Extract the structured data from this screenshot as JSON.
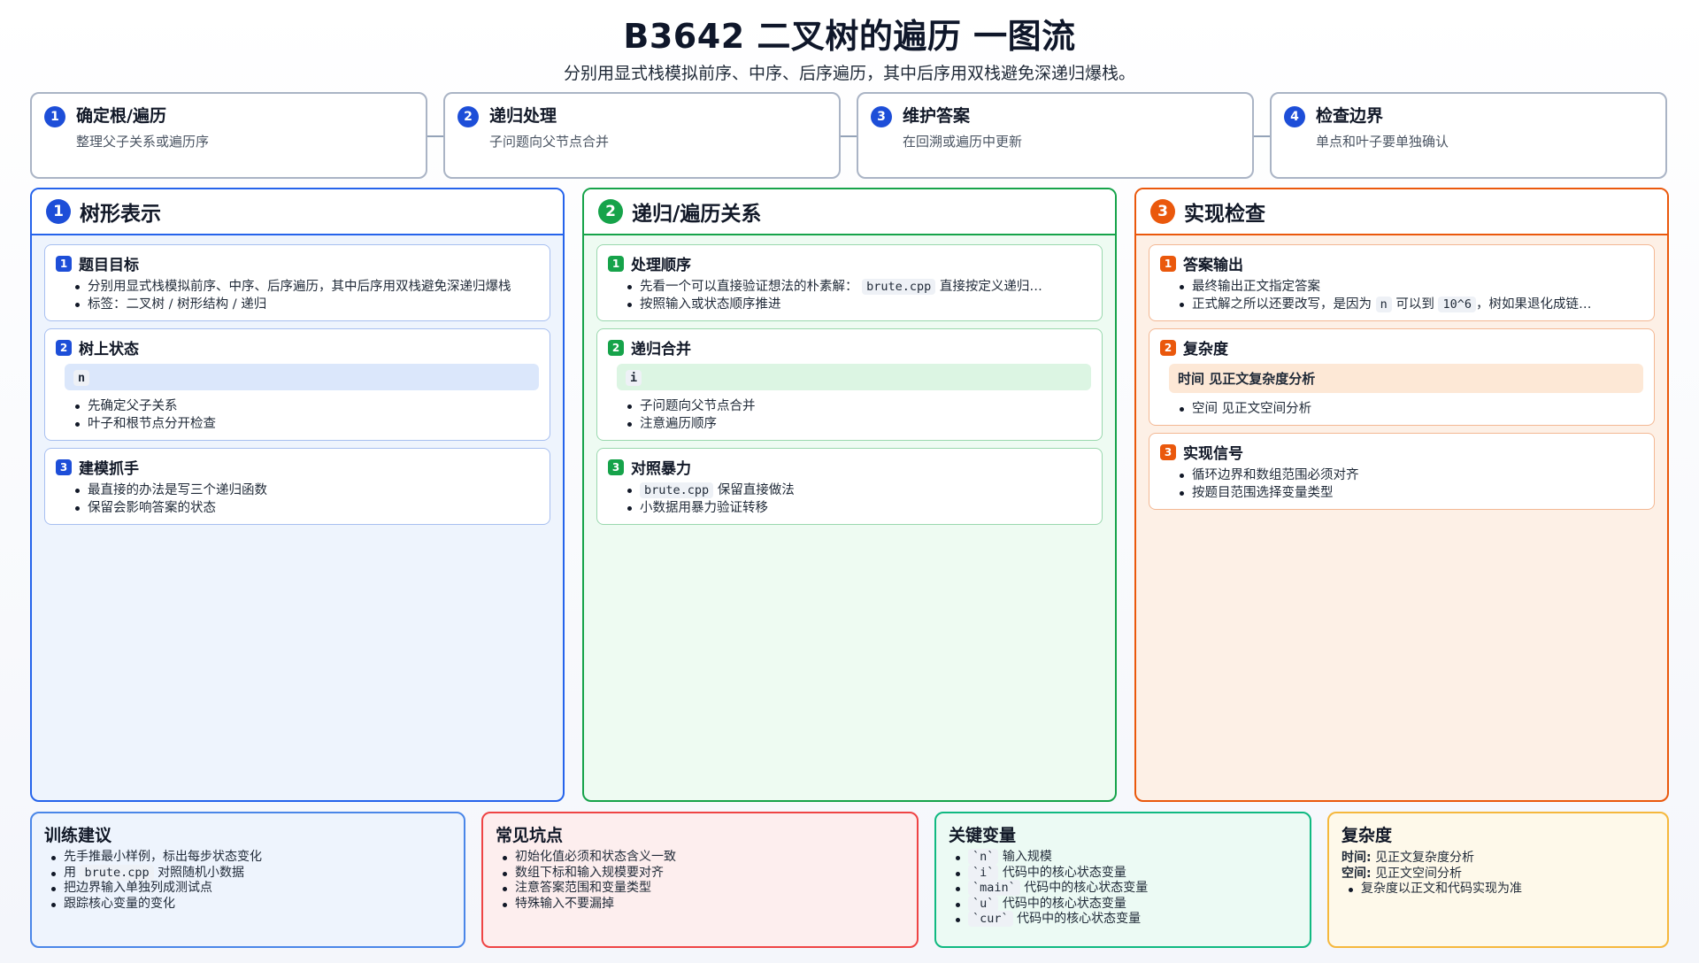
{
  "header": {
    "title": "B3642 二叉树的遍历 一图流",
    "subtitle": "分别用显式栈模拟前序、中序、后序遍历，其中后序用双栈避免深递归爆栈。"
  },
  "steps": [
    {
      "num": "1",
      "title": "确定根/遍历",
      "desc": "整理父子关系或遍历序"
    },
    {
      "num": "2",
      "title": "递归处理",
      "desc": "子问题向父节点合并"
    },
    {
      "num": "3",
      "title": "维护答案",
      "desc": "在回溯或遍历中更新"
    },
    {
      "num": "4",
      "title": "检查边界",
      "desc": "单点和叶子要单独确认"
    }
  ],
  "columns": {
    "tree": {
      "num": "1",
      "title": "树形表示",
      "card1": {
        "num": "1",
        "title": "题目目标",
        "item1": "分别用显式栈模拟前序、中序、后序遍历，其中后序用双栈避免深递归爆栈",
        "item2": "标签：二叉树 / 树形结构 / 递归"
      },
      "card2": {
        "num": "2",
        "title": "树上状态",
        "highlight": "n",
        "item1": "先确定父子关系",
        "item2": "叶子和根节点分开检查"
      },
      "card3": {
        "num": "3",
        "title": "建模抓手",
        "item1": "最直接的办法是写三个递归函数",
        "item2": "保留会影响答案的状态"
      }
    },
    "recur": {
      "num": "2",
      "title": "递归/遍历关系",
      "card1": {
        "num": "1",
        "title": "处理顺序",
        "item1_pre": "先看一个可以直接验证想法的朴素解：",
        "item1_code": "brute.cpp",
        "item1_post": "直接按定义递归…",
        "item2": "按照输入或状态顺序推进"
      },
      "card2": {
        "num": "2",
        "title": "递归合并",
        "highlight": "i",
        "item1": "子问题向父节点合并",
        "item2": "注意遍历顺序"
      },
      "card3": {
        "num": "3",
        "title": "对照暴力",
        "item1_code": "brute.cpp",
        "item1_post": "保留直接做法",
        "item2": "小数据用暴力验证转移"
      }
    },
    "impl": {
      "num": "3",
      "title": "实现检查",
      "card1": {
        "num": "1",
        "title": "答案输出",
        "item1": "最终输出正文指定答案",
        "item2_pre": "正式解之所以还要改写，是因为",
        "item2_code1": "n",
        "item2_mid": "可以到",
        "item2_code2": "10^6",
        "item2_post": "，树如果退化成链…"
      },
      "card2": {
        "num": "2",
        "title": "复杂度",
        "highlight": "时间 见正文复杂度分析",
        "item1": "空间 见正文空间分析"
      },
      "card3": {
        "num": "3",
        "title": "实现信号",
        "item1": "循环边界和数组范围必须对齐",
        "item2": "按题目范围选择变量类型"
      }
    }
  },
  "bottom": {
    "training": {
      "title": "训练建议",
      "item1": "先手推最小样例，标出每步状态变化",
      "item2_pre": "用",
      "item2_code": "brute.cpp",
      "item2_post": "对照随机小数据",
      "item3": "把边界输入单独列成测试点",
      "item4": "跟踪核心变量的变化"
    },
    "pitfalls": {
      "title": "常见坑点",
      "item1": "初始化值必须和状态含义一致",
      "item2": "数组下标和输入规模要对齐",
      "item3": "注意答案范围和变量类型",
      "item4": "特殊输入不要漏掉"
    },
    "vars": {
      "title": "关键变量",
      "v1_code": "`n`",
      "v1_desc": "输入规模",
      "v2_code": "`i`",
      "v2_desc": "代码中的核心状态变量",
      "v3_code": "`main`",
      "v3_desc": "代码中的核心状态变量",
      "v4_code": "`u`",
      "v4_desc": "代码中的核心状态变量",
      "v5_code": "`cur`",
      "v5_desc": "代码中的核心状态变量"
    },
    "complexity": {
      "title": "复杂度",
      "time_label": "时间:",
      "time_value": "见正文复杂度分析",
      "space_label": "空间:",
      "space_value": "见正文空间分析",
      "item1": "复杂度以正文和代码实现为准"
    }
  },
  "colors": {
    "blue": "#2563eb",
    "green": "#16a34a",
    "orange": "#ea580c",
    "red": "#ef4444",
    "teal": "#10b981",
    "amber": "#f59e0b"
  }
}
